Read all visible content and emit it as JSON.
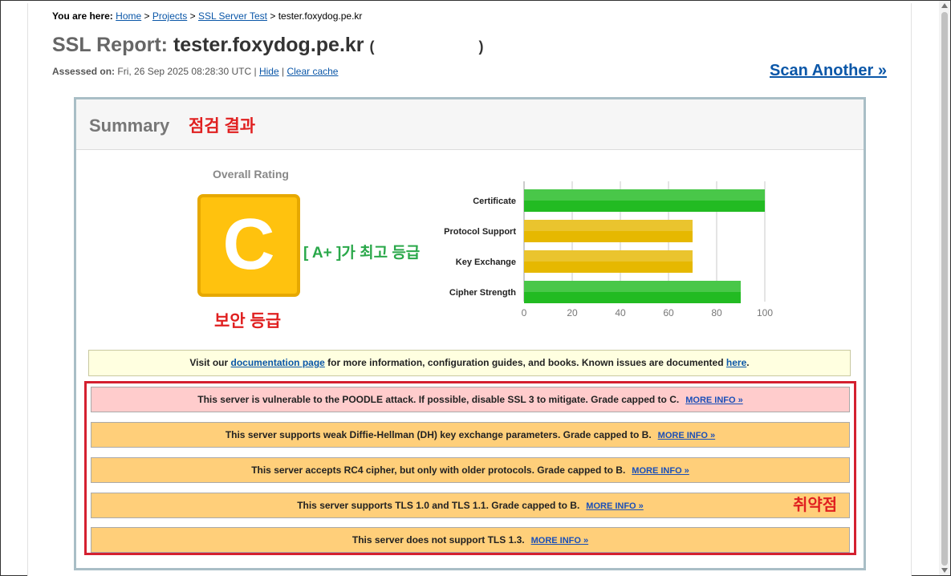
{
  "breadcrumb": {
    "prefix": "You are here:",
    "home": "Home",
    "projects": "Projects",
    "ssl_server_test": "SSL Server Test",
    "current": "tester.foxydog.pe.kr",
    "sep": ">"
  },
  "report": {
    "title_prefix": "SSL Report:",
    "host": "tester.foxydog.pe.kr",
    "paren_open": "(",
    "paren_close": ")",
    "assessed_label": "Assessed on:",
    "assessed_value": "Fri, 26 Sep 2025 08:28:30 UTC |",
    "hide": "Hide",
    "pipe": "|",
    "clear_cache": "Clear cache",
    "scan_another": "Scan Another »"
  },
  "summary": {
    "title": "Summary",
    "title_annotation": "점검 결과",
    "overall_rating_label": "Overall Rating",
    "grade": "C",
    "grade_annotation": "보안 등급",
    "top_grade_annotation": "[ A+ ]가 최고 등급",
    "grade_color": "#ffc20e"
  },
  "chart_data": {
    "type": "bar",
    "orientation": "horizontal",
    "categories": [
      "Certificate",
      "Protocol Support",
      "Key Exchange",
      "Cipher Strength"
    ],
    "values": [
      100,
      70,
      70,
      90
    ],
    "colors": [
      "#22bb22",
      "#e6b800",
      "#e6b800",
      "#22bb22"
    ],
    "xlim": [
      0,
      100
    ],
    "ticks": [
      0,
      20,
      40,
      60,
      80,
      100
    ],
    "grid": true
  },
  "info": {
    "text_before": "Visit our ",
    "doc_link": "documentation page",
    "text_middle": " for more information, configuration guides, and books. Known issues are documented ",
    "here_link": "here",
    "text_after": "."
  },
  "warnings": [
    {
      "text": "This server is vulnerable to the POODLE attack. If possible, disable SSL 3 to mitigate. Grade capped to C.",
      "link": "MORE INFO »",
      "severity": "red"
    },
    {
      "text": "This server supports weak Diffie-Hellman (DH) key exchange parameters. Grade capped to B.",
      "link": "MORE INFO »",
      "severity": "orange"
    },
    {
      "text": "This server accepts RC4 cipher, but only with older protocols. Grade capped to B.",
      "link": "MORE INFO »",
      "severity": "orange"
    },
    {
      "text": "This server supports TLS 1.0 and TLS 1.1. Grade capped to B.",
      "link": "MORE INFO »",
      "severity": "orange"
    },
    {
      "text": "This server does not support TLS 1.3.",
      "link": "MORE INFO »",
      "severity": "orange"
    }
  ],
  "vulnerability_annotation": "취약점"
}
